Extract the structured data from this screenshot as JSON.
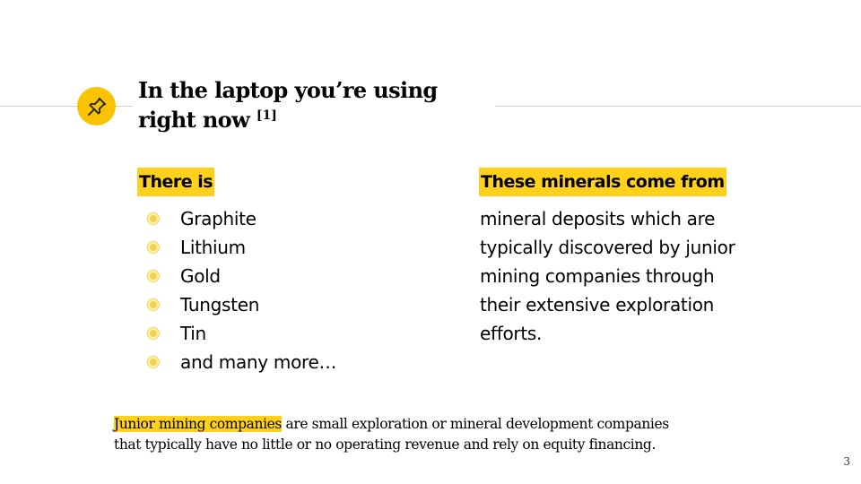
{
  "slide": {
    "title_line1": "In the laptop you’re using",
    "title_line2": "right now",
    "title_citation": "[1]",
    "title_icon": "pushpin-icon",
    "left_heading": "There is",
    "minerals": [
      "Graphite",
      "Lithium",
      "Gold",
      "Tungsten",
      "Tin",
      "and many more…"
    ],
    "right_heading": "These minerals come from",
    "right_paragraph_lines": [
      "mineral deposits which are",
      "typically discovered by junior",
      "mining companies through",
      "their extensive exploration",
      "efforts."
    ],
    "footnote_term": "Junior mining companies",
    "footnote_line1_rest": " are small exploration or mineral development companies",
    "footnote_line2": "that typically have no little or no operating revenue and rely on equity financing.",
    "page_number": "3"
  },
  "colors": {
    "accent_yellow": "#f9c300",
    "highlight_yellow": "#ffd11a",
    "rule_gray": "#d3d3d3"
  }
}
